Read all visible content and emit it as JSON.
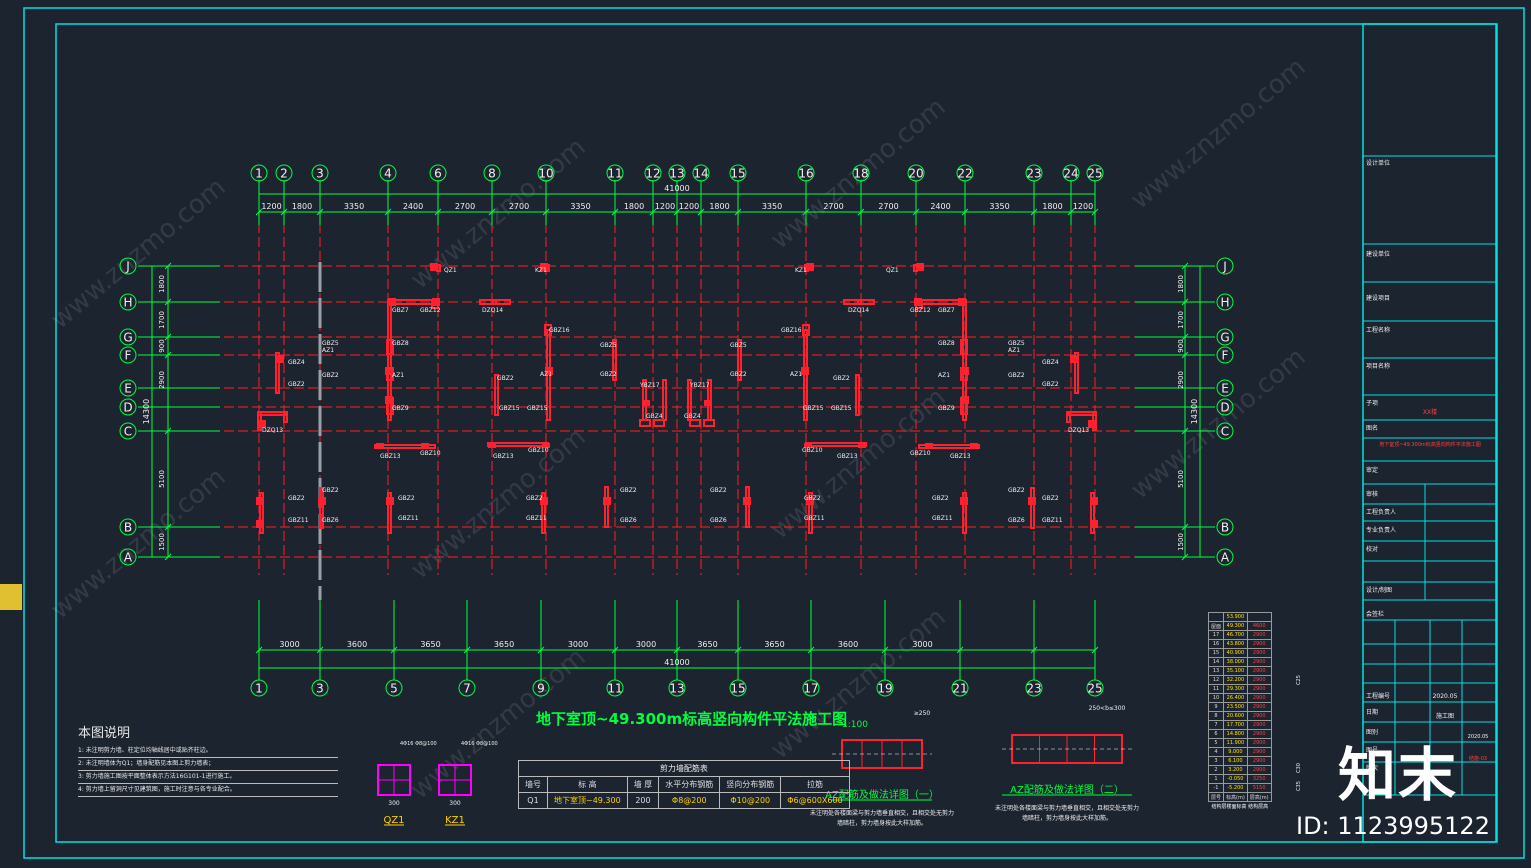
{
  "drawing": {
    "title": "地下室顶~49.300m标高竖向构件平法施工图",
    "scale": "1:100"
  },
  "colors": {
    "background": "#1c2430",
    "frame": "#00e0e0",
    "axis_line": "#ff2020",
    "dim": "#00ff40",
    "wall": "#ff2030",
    "label": "#f0f0f0",
    "highlight": "#ffd000"
  },
  "axes": {
    "top_x": [
      "1",
      "2",
      "3",
      "4",
      "6",
      "8",
      "10",
      "11",
      "12",
      "13",
      "14",
      "15",
      "16",
      "18",
      "20",
      "22",
      "23",
      "24",
      "25"
    ],
    "bottom_x": [
      "1",
      "3",
      "5",
      "7",
      "9",
      "11",
      "13",
      "15",
      "17",
      "19",
      "21",
      "23",
      "25"
    ],
    "y": [
      "J",
      "H",
      "G",
      "F",
      "E",
      "D",
      "C",
      "B",
      "A"
    ]
  },
  "dimensions": {
    "top_segments": [
      "1200",
      "1800",
      "3350",
      "2400",
      "2700",
      "2700",
      "3350",
      "1800",
      "1200",
      "1200",
      "1800",
      "3350",
      "2700",
      "2700",
      "2400",
      "3350",
      "1800",
      "1200"
    ],
    "top_total": "41000",
    "bottom_segments": [
      "3000",
      "3600",
      "3650",
      "3650",
      "3000",
      "3000",
      "3650",
      "3650",
      "3600",
      "3000"
    ],
    "bottom_total": "41000",
    "left_segments": [
      "1800",
      "1700",
      "900",
      "2900",
      "5100",
      "1500"
    ],
    "left_total": "14300",
    "right_segments": [
      "1800",
      "1700",
      "900",
      "2900",
      "5100",
      "1500"
    ],
    "right_total": "14300"
  },
  "components": [
    {
      "id": "GBZ7",
      "name": "GBZ7"
    },
    {
      "id": "GBZ12",
      "name": "GBZ12"
    },
    {
      "id": "GBZ8",
      "name": "GBZ8"
    },
    {
      "id": "AZ1",
      "name": "AZ1"
    },
    {
      "id": "GBZ9",
      "name": "GBZ9"
    },
    {
      "id": "GBZ13",
      "name": "GBZ13"
    },
    {
      "id": "GBZ10",
      "name": "GBZ10"
    },
    {
      "id": "GBZ15",
      "name": "GBZ15"
    },
    {
      "id": "GBZ16",
      "name": "GBZ16"
    },
    {
      "id": "GBZ5",
      "name": "GBZ5"
    },
    {
      "id": "YBZ17",
      "name": "YBZ17"
    },
    {
      "id": "GBZ4",
      "name": "GBZ4"
    },
    {
      "id": "GBZ3",
      "name": "GBZ3"
    },
    {
      "id": "GBZ2",
      "name": "GBZ2"
    },
    {
      "id": "GBZ11",
      "name": "GBZ11"
    },
    {
      "id": "GBZ6",
      "name": "GBZ6"
    },
    {
      "id": "DZQ13",
      "name": "DZQ13"
    },
    {
      "id": "DZQ14",
      "name": "DZQ14"
    },
    {
      "id": "QZ1",
      "name": "QZ1"
    },
    {
      "id": "KZ1",
      "name": "KZ1"
    }
  ],
  "notes": {
    "title": "本图说明",
    "items": [
      "1:  未注明剪力墙、柱定位均轴线居中或贴齐柱边。",
      "2:  未注明墙体为Q1；墙身配筋见本图上剪力墙表；",
      "3:  剪力墙施工图按平面整体表示方法16G101-1进行施工。",
      "4:  剪力墙上留洞尺寸见建筑图，施工时注意与各专业配合。"
    ]
  },
  "column_details": [
    {
      "label": "QZ1",
      "size": "300",
      "top": "4Φ16 Φ8@100"
    },
    {
      "label": "KZ1",
      "size": "300",
      "top": "4Φ16 Φ8@100"
    }
  ],
  "wall_table": {
    "caption": "剪力墙配筋表",
    "headers": [
      "墙号",
      "标 高",
      "墙 厚",
      "水平分布钢筋",
      "竖向分布钢筋",
      "拉筋"
    ],
    "rows": [
      [
        "Q1",
        "地下室顶~49.300",
        "200",
        "Φ8@200",
        "Φ10@200",
        "Φ6@600X600"
      ]
    ]
  },
  "details": [
    {
      "title": "AZ配筋及做法详图（一）",
      "note": "未注明处各楼面梁与剪力墙垂直相交，且相交处无剪力墙暗柱，剪力墙身按此大样加筋。",
      "dim": "≥250"
    },
    {
      "title": "AZ配筋及做法详图（二）",
      "note": "未注明处各楼面梁与剪力墙垂直相交，且相交处无剪力墙暗柱，剪力墙身按此大样加筋。",
      "dim": "250<b≤300"
    }
  ],
  "elevation_table": {
    "caption": "结构层楼面标高  结构层高",
    "top": "53.900",
    "rows": [
      [
        "屋面",
        "49.300",
        "4600"
      ],
      [
        "17",
        "46.700",
        "2900"
      ],
      [
        "16",
        "43.800",
        "2900"
      ],
      [
        "15",
        "40.900",
        "2900"
      ],
      [
        "14",
        "38.000",
        "2900"
      ],
      [
        "13",
        "35.100",
        "2900"
      ],
      [
        "12",
        "32.200",
        "2900"
      ],
      [
        "11",
        "29.300",
        "2900"
      ],
      [
        "10",
        "26.400",
        "2900"
      ],
      [
        "9",
        "23.500",
        "2900"
      ],
      [
        "8",
        "20.600",
        "2900"
      ],
      [
        "7",
        "17.700",
        "2900"
      ],
      [
        "6",
        "14.800",
        "2900"
      ],
      [
        "5",
        "11.900",
        "2900"
      ],
      [
        "4",
        "9.000",
        "2900"
      ],
      [
        "3",
        "6.100",
        "2900"
      ],
      [
        "2",
        "3.200",
        "2900"
      ],
      [
        "1",
        "-0.050",
        "3250"
      ],
      [
        "-1",
        "-5.200",
        "5150"
      ]
    ],
    "footer": [
      "层号",
      "标高(m)",
      "层高(m)"
    ],
    "grade_labels": [
      "C25",
      "C30",
      "C35"
    ]
  },
  "title_block": {
    "rows": [
      "设计单位",
      "建设单位",
      "建设项目",
      "工程名称",
      "项目名称",
      "子项",
      "图名",
      "审定",
      "审核",
      "工程负责人",
      "专业负责人",
      "校对",
      "设计/制图",
      "会签栏",
      "工程编号",
      "日期",
      "图别",
      "图号",
      "版次"
    ],
    "values": {
      "project": "XX楼",
      "drawing_name": "地下室顶~49.300m标高竖向构件平法施工图",
      "date": "2020.05",
      "discipline": "结施",
      "sheet_no": "结施-03",
      "version": "2020.05",
      "stage": "施工图"
    }
  },
  "watermark": {
    "logo": "知末",
    "id": "ID: 1123995122",
    "site": "www.znzmo.com"
  }
}
